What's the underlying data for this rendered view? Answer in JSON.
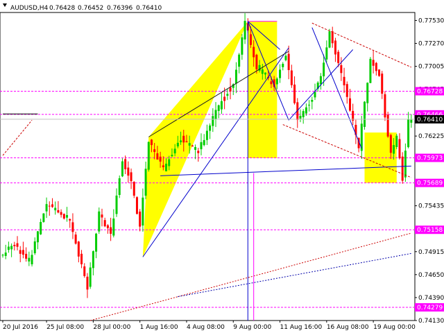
{
  "header": {
    "symbol": "AUDUSD,H4",
    "open": "0.76428",
    "high": "0.76452",
    "low": "0.76396",
    "close": "0.76410"
  },
  "chart_data": {
    "type": "candlestick",
    "symbol": "AUDUSD",
    "timeframe": "H4",
    "ylim": [
      0.7413,
      0.7762
    ],
    "y_ticks": [
      0.7413,
      0.7439,
      0.7465,
      0.7491,
      0.7517,
      0.7543,
      0.7569,
      0.7596,
      0.7622,
      0.7648,
      0.7675,
      0.7701,
      0.7727,
      0.7753
    ],
    "y_tick_labels": [
      "0.74130",
      "0.74390",
      "0.74650",
      "0.74915",
      "0.75175",
      "0.75435",
      "0.75695",
      "0.75960",
      "0.76225",
      "0.76480",
      "0.76745",
      "0.77005",
      "0.77270",
      "0.77530"
    ],
    "x_tick_labels": [
      "20 Jul 2016",
      "25 Jul 08:00",
      "28 Jul 00:00",
      "1 Aug 16:00",
      "4 Aug 08:00",
      "9 Aug 00:00",
      "11 Aug 16:00",
      "16 Aug 08:00",
      "19 Aug 00:00"
    ],
    "x_tick_bars": [
      0,
      15,
      31,
      47,
      63,
      79,
      95,
      111,
      127
    ],
    "n_bars": 141,
    "current_price": 0.7641,
    "current_price_label": "0.76410",
    "colors": {
      "up": "#00cc00",
      "down": "#ff0000",
      "zone": "#ffff00",
      "level": "#ff00ff",
      "trend": "#0000cc"
    },
    "levels": [
      {
        "value": 0.76728,
        "label": "0.76728"
      },
      {
        "value": 0.76466,
        "label": "0.76466"
      },
      {
        "value": 0.75973,
        "label": "0.75973"
      },
      {
        "value": 0.75689,
        "label": "0.75689"
      },
      {
        "value": 0.75158,
        "label": "0.75158"
      },
      {
        "value": 0.74279,
        "label": "0.74279"
      }
    ],
    "anchors": [
      {
        "bar": 0,
        "price": 0.7485
      },
      {
        "bar": 5,
        "price": 0.75
      },
      {
        "bar": 10,
        "price": 0.7478
      },
      {
        "bar": 16,
        "price": 0.7545
      },
      {
        "bar": 24,
        "price": 0.7525
      },
      {
        "bar": 30,
        "price": 0.745
      },
      {
        "bar": 34,
        "price": 0.7535
      },
      {
        "bar": 38,
        "price": 0.751
      },
      {
        "bar": 42,
        "price": 0.7595
      },
      {
        "bar": 45,
        "price": 0.757
      },
      {
        "bar": 48,
        "price": 0.752
      },
      {
        "bar": 51,
        "price": 0.7615
      },
      {
        "bar": 56,
        "price": 0.7585
      },
      {
        "bar": 62,
        "price": 0.762
      },
      {
        "bar": 68,
        "price": 0.7605
      },
      {
        "bar": 74,
        "price": 0.765
      },
      {
        "bar": 80,
        "price": 0.768
      },
      {
        "bar": 84,
        "price": 0.7752
      },
      {
        "bar": 88,
        "price": 0.77
      },
      {
        "bar": 94,
        "price": 0.768
      },
      {
        "bar": 98,
        "price": 0.7715
      },
      {
        "bar": 102,
        "price": 0.764
      },
      {
        "bar": 107,
        "price": 0.7665
      },
      {
        "bar": 110,
        "price": 0.769
      },
      {
        "bar": 113,
        "price": 0.774
      },
      {
        "bar": 118,
        "price": 0.768
      },
      {
        "bar": 123,
        "price": 0.7608
      },
      {
        "bar": 127,
        "price": 0.771
      },
      {
        "bar": 130,
        "price": 0.769
      },
      {
        "bar": 134,
        "price": 0.76
      },
      {
        "bar": 136,
        "price": 0.762
      },
      {
        "bar": 138,
        "price": 0.7573
      },
      {
        "bar": 140,
        "price": 0.764
      }
    ]
  }
}
